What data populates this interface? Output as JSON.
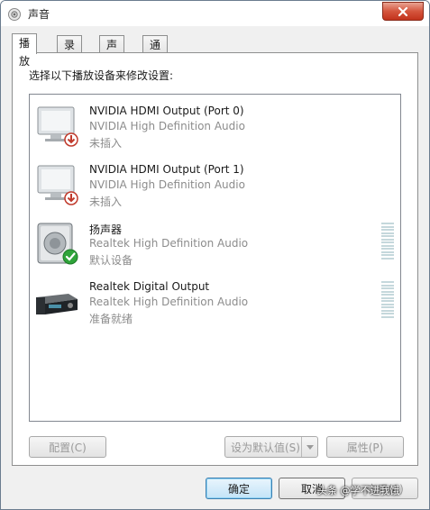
{
  "window": {
    "title": "声音"
  },
  "tabs": [
    {
      "label": "播放",
      "active": true
    },
    {
      "label": "录制",
      "active": false
    },
    {
      "label": "声音",
      "active": false
    },
    {
      "label": "通信",
      "active": false
    }
  ],
  "main": {
    "instructions": "选择以下播放设备来修改设置:",
    "devices": [
      {
        "name": "NVIDIA HDMI Output (Port 0)",
        "driver": "NVIDIA High Definition Audio",
        "status": "未插入",
        "icon": "monitor-unplugged-icon"
      },
      {
        "name": "NVIDIA HDMI Output (Port 1)",
        "driver": "NVIDIA High Definition Audio",
        "status": "未插入",
        "icon": "monitor-unplugged-icon"
      },
      {
        "name": "扬声器",
        "driver": "Realtek High Definition Audio",
        "status": "默认设备",
        "icon": "speaker-default-icon"
      },
      {
        "name": "Realtek Digital Output",
        "driver": "Realtek High Definition Audio",
        "status": "准备就绪",
        "icon": "digital-receiver-icon"
      }
    ]
  },
  "actions": {
    "configure": "配置(C)",
    "set_default": "设为默认值(S)",
    "properties": "属性(P)"
  },
  "dialog": {
    "ok": "确定",
    "cancel": "取消",
    "apply": "应用(A)"
  },
  "watermark": "头条 @学不进我饿",
  "colors": {
    "close_red": "#c94a32",
    "level_meter": "#c5d8dc",
    "default_check": "#2fa43a",
    "unplugged_red": "#c0392b"
  }
}
